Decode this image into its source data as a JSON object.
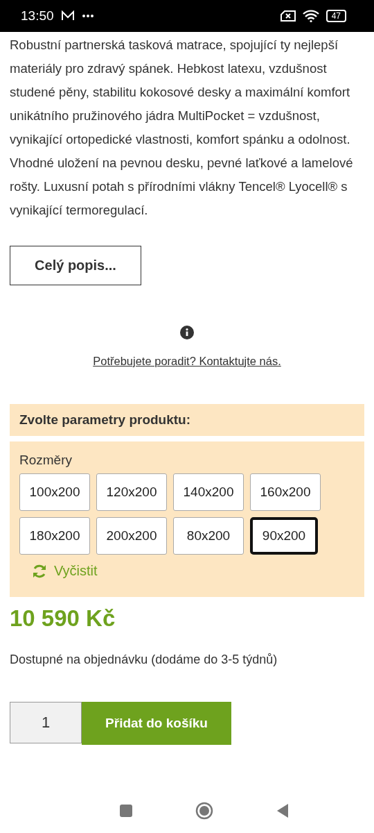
{
  "status_bar": {
    "time": "13:50",
    "battery": "47"
  },
  "description": "Robustní partnerská tasková matrace, spojující ty nejlepší materiály pro zdravý spánek. Hebkost latexu, vzdušnost studené pěny, stabilitu kokosové desky a maximální komfort unikátního pružinového jádra MultiPocket = vzdušnost, vynikající ortopedické vlastnosti, komfort spánku a odolnost. Vhodné uložení na pevnou desku, pevné laťkové a lamelové rošty. Luxusní potah s přírodními vlákny Tencel® Lyocell® s vynikající termoregulací.",
  "full_description_button": "Celý popis...",
  "help_link": "Potřebujete poradit? Kontaktujte nás.",
  "parameters": {
    "title": "Zvolte parametry produktu:",
    "label": "Rozměry",
    "sizes": [
      {
        "label": "100x200",
        "selected": false
      },
      {
        "label": "120x200",
        "selected": false
      },
      {
        "label": "140x200",
        "selected": false
      },
      {
        "label": "160x200",
        "selected": false
      },
      {
        "label": "180x200",
        "selected": false
      },
      {
        "label": "200x200",
        "selected": false
      },
      {
        "label": "80x200",
        "selected": false
      },
      {
        "label": "90x200",
        "selected": true
      }
    ],
    "clear": "Vyčistit"
  },
  "price": "10 590 Kč",
  "availability": "Dostupné na objednávku (dodáme do 3-5 týdnů)",
  "quantity": "1",
  "add_to_cart": "Přidat do košíku"
}
